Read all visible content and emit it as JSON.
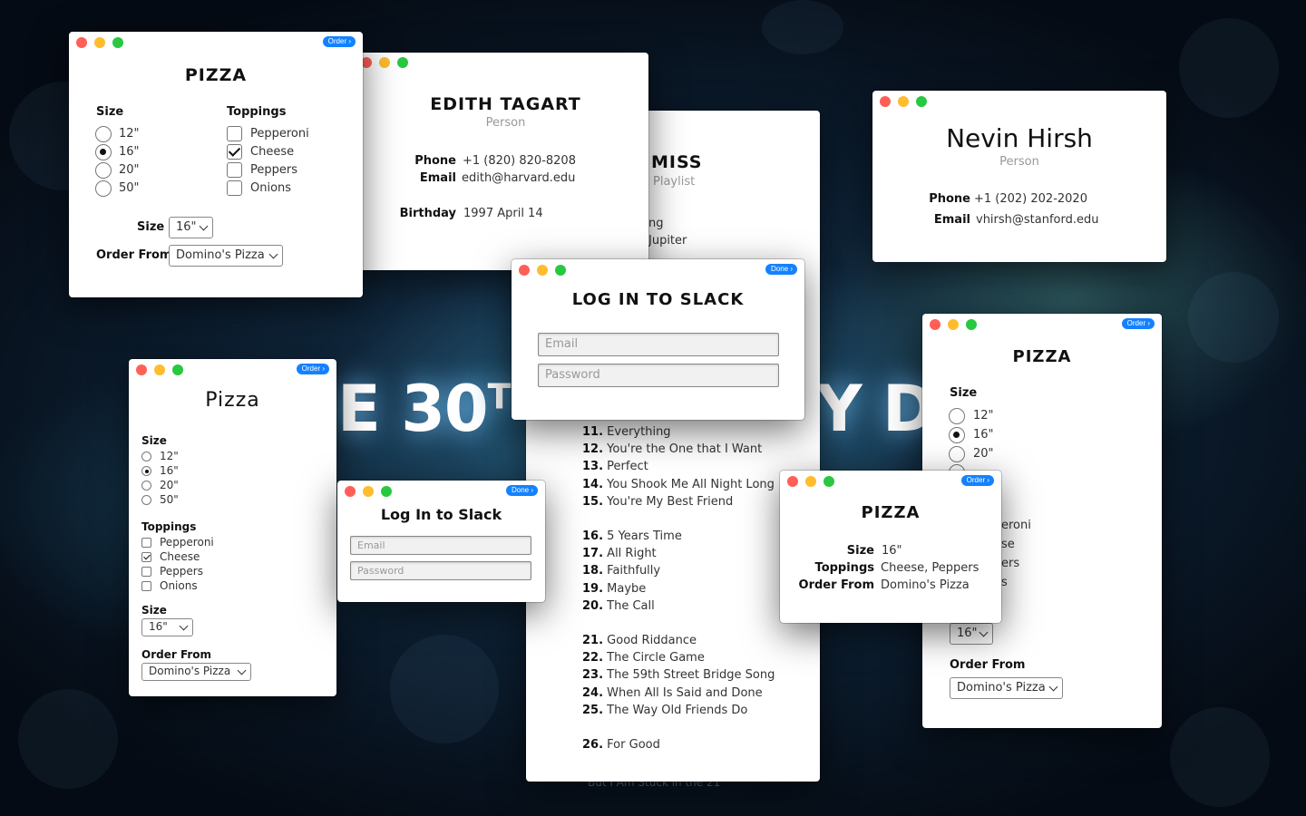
{
  "background": {
    "banner_left": "E 30",
    "banner_sup": "TH",
    "banner_right": "Y D",
    "footer": "But I Am Stuck in the 21",
    "footer_sup": "st"
  },
  "pizza_window_1": {
    "title": "PIZZA",
    "badge": "Order ›",
    "size_label": "Size",
    "toppings_label": "Toppings",
    "sizes": [
      {
        "label": "12\"",
        "selected": false
      },
      {
        "label": "16\"",
        "selected": true
      },
      {
        "label": "20\"",
        "selected": false
      },
      {
        "label": "50\"",
        "selected": false
      }
    ],
    "toppings": [
      {
        "label": "Pepperoni",
        "checked": false
      },
      {
        "label": "Cheese",
        "checked": true
      },
      {
        "label": "Peppers",
        "checked": false
      },
      {
        "label": "Onions",
        "checked": false
      }
    ],
    "size_select_label": "Size",
    "size_select_value": "16\"",
    "order_from_label": "Order From",
    "order_from_value": "Domino's Pizza"
  },
  "contact_edith": {
    "name": "EDITH TAGART",
    "subtitle": "Person",
    "phone_label": "Phone",
    "phone_value": "+1 (820) 820-8208",
    "email_label": "Email",
    "email_value": "edith@harvard.edu",
    "birthday_label": "Birthday",
    "birthday_value": "1997 April 14"
  },
  "playlist_window": {
    "title_partial": "MISS",
    "subtitle": "Playlist",
    "partial_items": [
      "ng",
      "Jupiter"
    ],
    "tracks": [
      {
        "num": "11.",
        "title": "Everything"
      },
      {
        "num": "12.",
        "title": "You're the One that I Want"
      },
      {
        "num": "13.",
        "title": "Perfect"
      },
      {
        "num": "14.",
        "title": "You Shook Me All Night Long"
      },
      {
        "num": "15.",
        "title": "You're My Best Friend"
      },
      {
        "num": "16.",
        "title": "5 Years Time"
      },
      {
        "num": "17.",
        "title": "All Right"
      },
      {
        "num": "18.",
        "title": "Faithfully"
      },
      {
        "num": "19.",
        "title": "Maybe"
      },
      {
        "num": "20.",
        "title": "The Call"
      },
      {
        "num": "21.",
        "title": "Good Riddance"
      },
      {
        "num": "22.",
        "title": "The Circle Game"
      },
      {
        "num": "23.",
        "title": "The 59th Street Bridge Song"
      },
      {
        "num": "24.",
        "title": "When All Is Said and Done"
      },
      {
        "num": "25.",
        "title": "The Way Old Friends Do"
      },
      {
        "num": "26.",
        "title": "For Good"
      }
    ]
  },
  "contact_nevin": {
    "name": "Nevin Hirsh",
    "subtitle": "Person",
    "phone_label": "Phone",
    "phone_value": "+1 (202) 202-2020",
    "email_label": "Email",
    "email_value": "vhirsh@stanford.edu"
  },
  "slack_login_large": {
    "title": "LOG IN TO SLACK",
    "badge": "Done ›",
    "email_placeholder": "Email",
    "password_placeholder": "Password"
  },
  "pizza_window_2": {
    "title": "Pizza",
    "badge": "Order ›",
    "size_label": "Size",
    "sizes": [
      {
        "label": "12\"",
        "selected": false
      },
      {
        "label": "16\"",
        "selected": true
      },
      {
        "label": "20\"",
        "selected": false
      },
      {
        "label": "50\"",
        "selected": false
      }
    ],
    "toppings_label": "Toppings",
    "toppings": [
      {
        "label": "Pepperoni",
        "checked": false
      },
      {
        "label": "Cheese",
        "checked": true
      },
      {
        "label": "Peppers",
        "checked": false
      },
      {
        "label": "Onions",
        "checked": false
      }
    ],
    "size_select_label": "Size",
    "size_select_value": "16\"",
    "order_from_label": "Order From",
    "order_from_value": "Domino's Pizza"
  },
  "slack_login_small": {
    "title": "Log In to Slack",
    "badge": "Done ›",
    "email_placeholder": "Email",
    "password_placeholder": "Password"
  },
  "pizza_window_3": {
    "title": "PIZZA",
    "badge": "Order ›",
    "size_label": "Size",
    "sizes": [
      {
        "label": "12\"",
        "selected": false
      },
      {
        "label": "16\"",
        "selected": true
      },
      {
        "label": "20\"",
        "selected": false
      }
    ],
    "partial_toppings": [
      "eroni",
      "se",
      "ers",
      "s"
    ],
    "size_select_value": "16\"",
    "order_from_label": "Order From",
    "order_from_value": "Domino's Pizza"
  },
  "pizza_summary": {
    "title": "PIZZA",
    "badge": "Order ›",
    "size_label": "Size",
    "size_value": "16\"",
    "toppings_label": "Toppings",
    "toppings_value": "Cheese, Peppers",
    "order_from_label": "Order From",
    "order_from_value": "Domino's Pizza"
  },
  "colors": {
    "accent_blue": "#1482ff",
    "traffic_red": "#ff5f57",
    "traffic_yellow": "#febc2e",
    "traffic_green": "#28c840"
  }
}
